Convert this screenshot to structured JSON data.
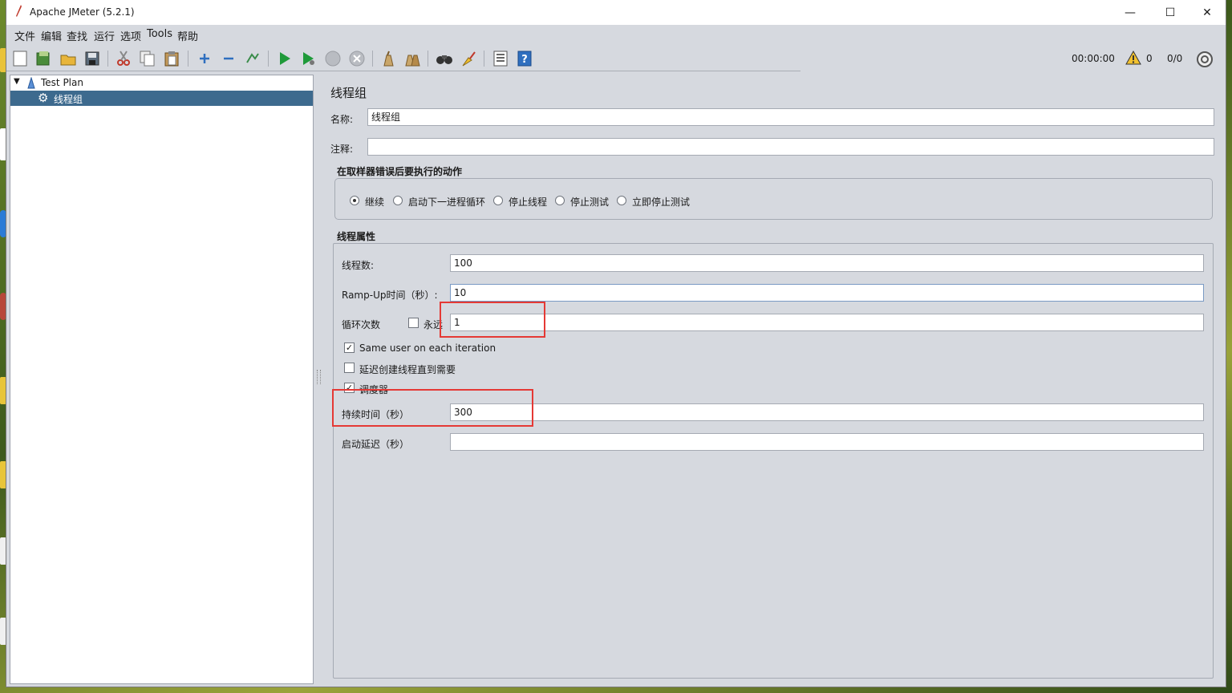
{
  "window": {
    "title": "Apache JMeter (5.2.1)",
    "minimize": "—",
    "maximize": "☐",
    "close": "✕"
  },
  "menu": [
    "文件",
    "编辑",
    "查找",
    "运行",
    "选项",
    "Tools",
    "帮助"
  ],
  "toolbar": {
    "icons": [
      "new-icon",
      "templates-icon",
      "open-icon",
      "save-icon",
      "cut-icon",
      "copy-icon",
      "paste-icon",
      "expand-icon",
      "collapse-icon",
      "toggle-icon",
      "start-icon",
      "start-no-timers-icon",
      "stop-icon",
      "shutdown-icon",
      "clear-icon",
      "clear-all-icon",
      "search-icon",
      "reset-search-icon",
      "function-helper-icon",
      "help-icon"
    ],
    "timer": "00:00:00",
    "warnings": "0",
    "threads": "0/0"
  },
  "tree": {
    "root": "Test Plan",
    "child": "线程组"
  },
  "panel": {
    "heading": "线程组",
    "name_label": "名称:",
    "name_value": "线程组",
    "comment_label": "注释:",
    "comment_value": "",
    "error_group_title": "在取样器错误后要执行的动作",
    "error_actions": [
      "继续",
      "启动下一进程循环",
      "停止线程",
      "停止测试",
      "立即停止测试"
    ],
    "error_selected": "继续",
    "thread_group_title": "线程属性",
    "threads_label": "线程数:",
    "threads_value": "100",
    "rampup_label": "Ramp-Up时间（秒）:",
    "rampup_value": "10",
    "loop_label": "循环次数",
    "forever_label": "永远",
    "forever_checked": false,
    "loop_value": "1",
    "same_user_label": "Same user on each iteration",
    "same_user_checked": true,
    "delay_create_label": "延迟创建线程直到需要",
    "delay_create_checked": false,
    "scheduler_label": "调度器",
    "scheduler_checked": true,
    "duration_label": "持续时间（秒）",
    "duration_value": "300",
    "startup_delay_label": "启动延迟（秒）",
    "startup_delay_value": ""
  },
  "colors": {
    "highlight": "#e53935",
    "selection": "#3d6a8e"
  }
}
